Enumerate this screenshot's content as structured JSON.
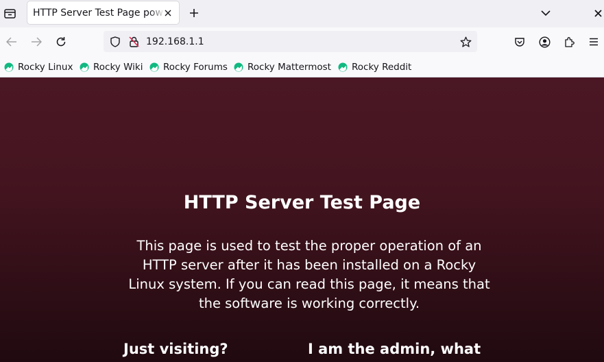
{
  "browser": {
    "tab": {
      "title": "HTTP Server Test Page powered by Rocky Linux"
    },
    "address": {
      "url": "192.168.1.1"
    },
    "bookmarks": [
      {
        "label": "Rocky Linux"
      },
      {
        "label": "Rocky Wiki"
      },
      {
        "label": "Rocky Forums"
      },
      {
        "label": "Rocky Mattermost"
      },
      {
        "label": "Rocky Reddit"
      }
    ],
    "colors": {
      "accent": "#10b981",
      "page_bg": "#4b1724"
    },
    "icons": [
      "tab-overflow-icon",
      "close-icon",
      "plus-icon",
      "chevron-down-icon",
      "back-arrow-icon",
      "forward-arrow-icon",
      "reload-icon",
      "shield-icon",
      "insecure-lock-icon",
      "star-icon",
      "pocket-icon",
      "account-icon",
      "extensions-icon",
      "menu-icon",
      "rocky-logo-icon"
    ]
  },
  "page": {
    "title": "HTTP Server Test Page",
    "description": "This page is used to test the proper operation of an HTTP server after it has been installed on a Rocky Linux system. If you can read this page, it means that the software is working correctly.",
    "sections": [
      {
        "heading": "Just visiting?"
      },
      {
        "heading": "I am the admin, what"
      }
    ]
  }
}
